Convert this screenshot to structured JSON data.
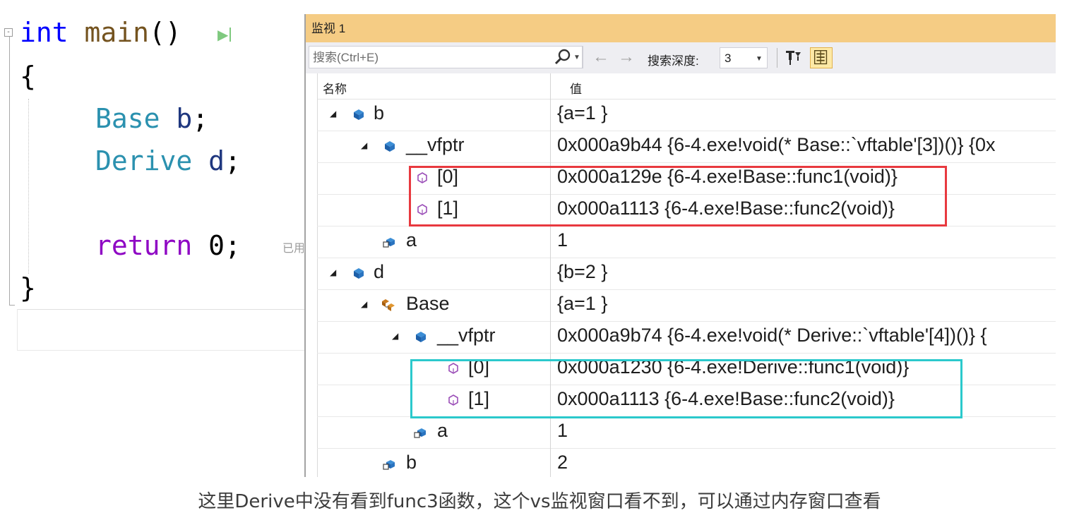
{
  "editor": {
    "lines": {
      "l1": [
        "int",
        " ",
        "main",
        "()"
      ],
      "l2": [
        "{"
      ],
      "l3": [
        "Base",
        " ",
        "b",
        ";"
      ],
      "l4": [
        "Derive",
        " ",
        "d",
        ";"
      ],
      "l6": [
        "return",
        " ",
        "0",
        ";"
      ],
      "l7": [
        "}"
      ]
    },
    "fold_marker": "-",
    "elapsed_hint": "已用"
  },
  "watch": {
    "title": "监视 1",
    "search_placeholder": "搜索(Ctrl+E)",
    "nav_back": "←",
    "nav_forward": "→",
    "depth_label": "搜索深度:",
    "depth_value": "3",
    "columns": {
      "name": "名称",
      "value": "值"
    },
    "rows": [
      {
        "name": "b",
        "value": "{a=1 }",
        "icon": "object-icon",
        "expanded": true
      },
      {
        "name": "__vfptr",
        "value": "0x000a9b44 {6-4.exe!void(* Base::`vftable'[3])()} {0x",
        "icon": "object-icon",
        "expanded": true
      },
      {
        "name": "[0]",
        "value": "0x000a129e {6-4.exe!Base::func1(void)}",
        "icon": "method-icon"
      },
      {
        "name": "[1]",
        "value": "0x000a1113 {6-4.exe!Base::func2(void)}",
        "icon": "method-icon"
      },
      {
        "name": "a",
        "value": "1",
        "icon": "field-icon"
      },
      {
        "name": "d",
        "value": "{b=2 }",
        "icon": "object-icon",
        "expanded": true
      },
      {
        "name": "Base",
        "value": "{a=1 }",
        "icon": "base-class-icon",
        "expanded": true
      },
      {
        "name": "__vfptr",
        "value": "0x000a9b74 {6-4.exe!void(* Derive::`vftable'[4])()} {",
        "icon": "object-icon",
        "expanded": true
      },
      {
        "name": "[0]",
        "value": "0x000a1230 {6-4.exe!Derive::func1(void)}",
        "icon": "method-icon"
      },
      {
        "name": "[1]",
        "value": "0x000a1113 {6-4.exe!Base::func2(void)}",
        "icon": "method-icon"
      },
      {
        "name": "a",
        "value": "1",
        "icon": "field-icon"
      },
      {
        "name": "b",
        "value": "2",
        "icon": "field-icon"
      }
    ],
    "expander_glyph": "◢"
  },
  "caption": "这里Derive中没有看到func3函数，这个vs监视窗口看不到，可以通过内存窗口查看",
  "colors": {
    "title_bar": "#f5cc84",
    "red_highlight": "#e8393f",
    "cyan_highlight": "#2bc9cc",
    "keyword": "#0000ff",
    "return_keyword": "#8f08c4",
    "type": "#2b91af"
  }
}
